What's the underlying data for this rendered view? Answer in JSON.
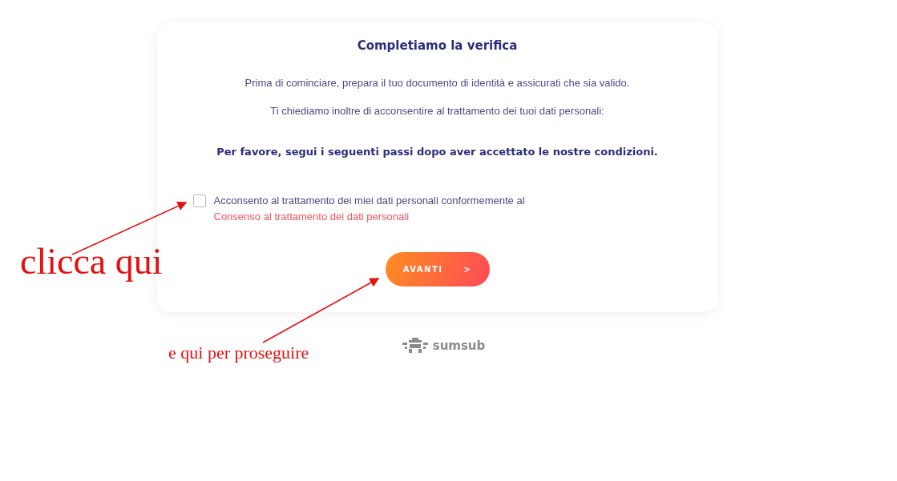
{
  "card": {
    "title": "Completiamo la verifica",
    "paragraphs": [
      "Prima di cominciare, prepara il tuo documento di identità e assicurati che sia valido.",
      "Ti chiediamo inoltre di acconsentire al trattamento dei tuoi dati personali:"
    ],
    "instruction": "Per favore, segui i seguenti passi dopo aver accettato le nostre condizioni.",
    "consent": {
      "checked": false,
      "text": "Acconsento al trattamento dei miei dati personali conformemente al",
      "link": "Consenso al trattamento dei dati personali"
    },
    "button": {
      "label": "AVANTI",
      "arrow": ">"
    }
  },
  "footer": {
    "logo": "sumsub"
  },
  "annotations": [
    {
      "text": "clicca qui",
      "kind": "large"
    },
    {
      "text": "e qui per proseguire",
      "kind": "small"
    }
  ]
}
